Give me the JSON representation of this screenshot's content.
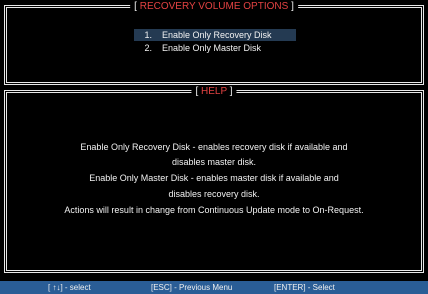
{
  "options_panel": {
    "bracket_open": "[",
    "title": "RECOVERY VOLUME OPTIONS",
    "bracket_close": "]",
    "items": [
      {
        "number": "1.",
        "label": "Enable Only Recovery Disk",
        "selected": true
      },
      {
        "number": "2.",
        "label": "Enable Only Master Disk",
        "selected": false
      }
    ]
  },
  "help_panel": {
    "bracket_open": "[",
    "title": "HELP",
    "bracket_close": "]",
    "lines": [
      "Enable Only Recovery Disk - enables recovery disk if available and",
      "disables master disk.",
      "Enable Only Master Disk - enables master disk if available and",
      "disables recovery disk.",
      "Actions will result in change from Continuous Update mode to On-Request."
    ]
  },
  "status_bar": {
    "select_hint": "[ ↑↓] - select",
    "esc_hint": "[ESC] - Previous Menu",
    "enter_hint": "[ENTER] - Select"
  },
  "colors": {
    "background": "#000000",
    "title_text": "#e34242",
    "selection": "#243a52",
    "status_bar": "#2a5d96"
  }
}
